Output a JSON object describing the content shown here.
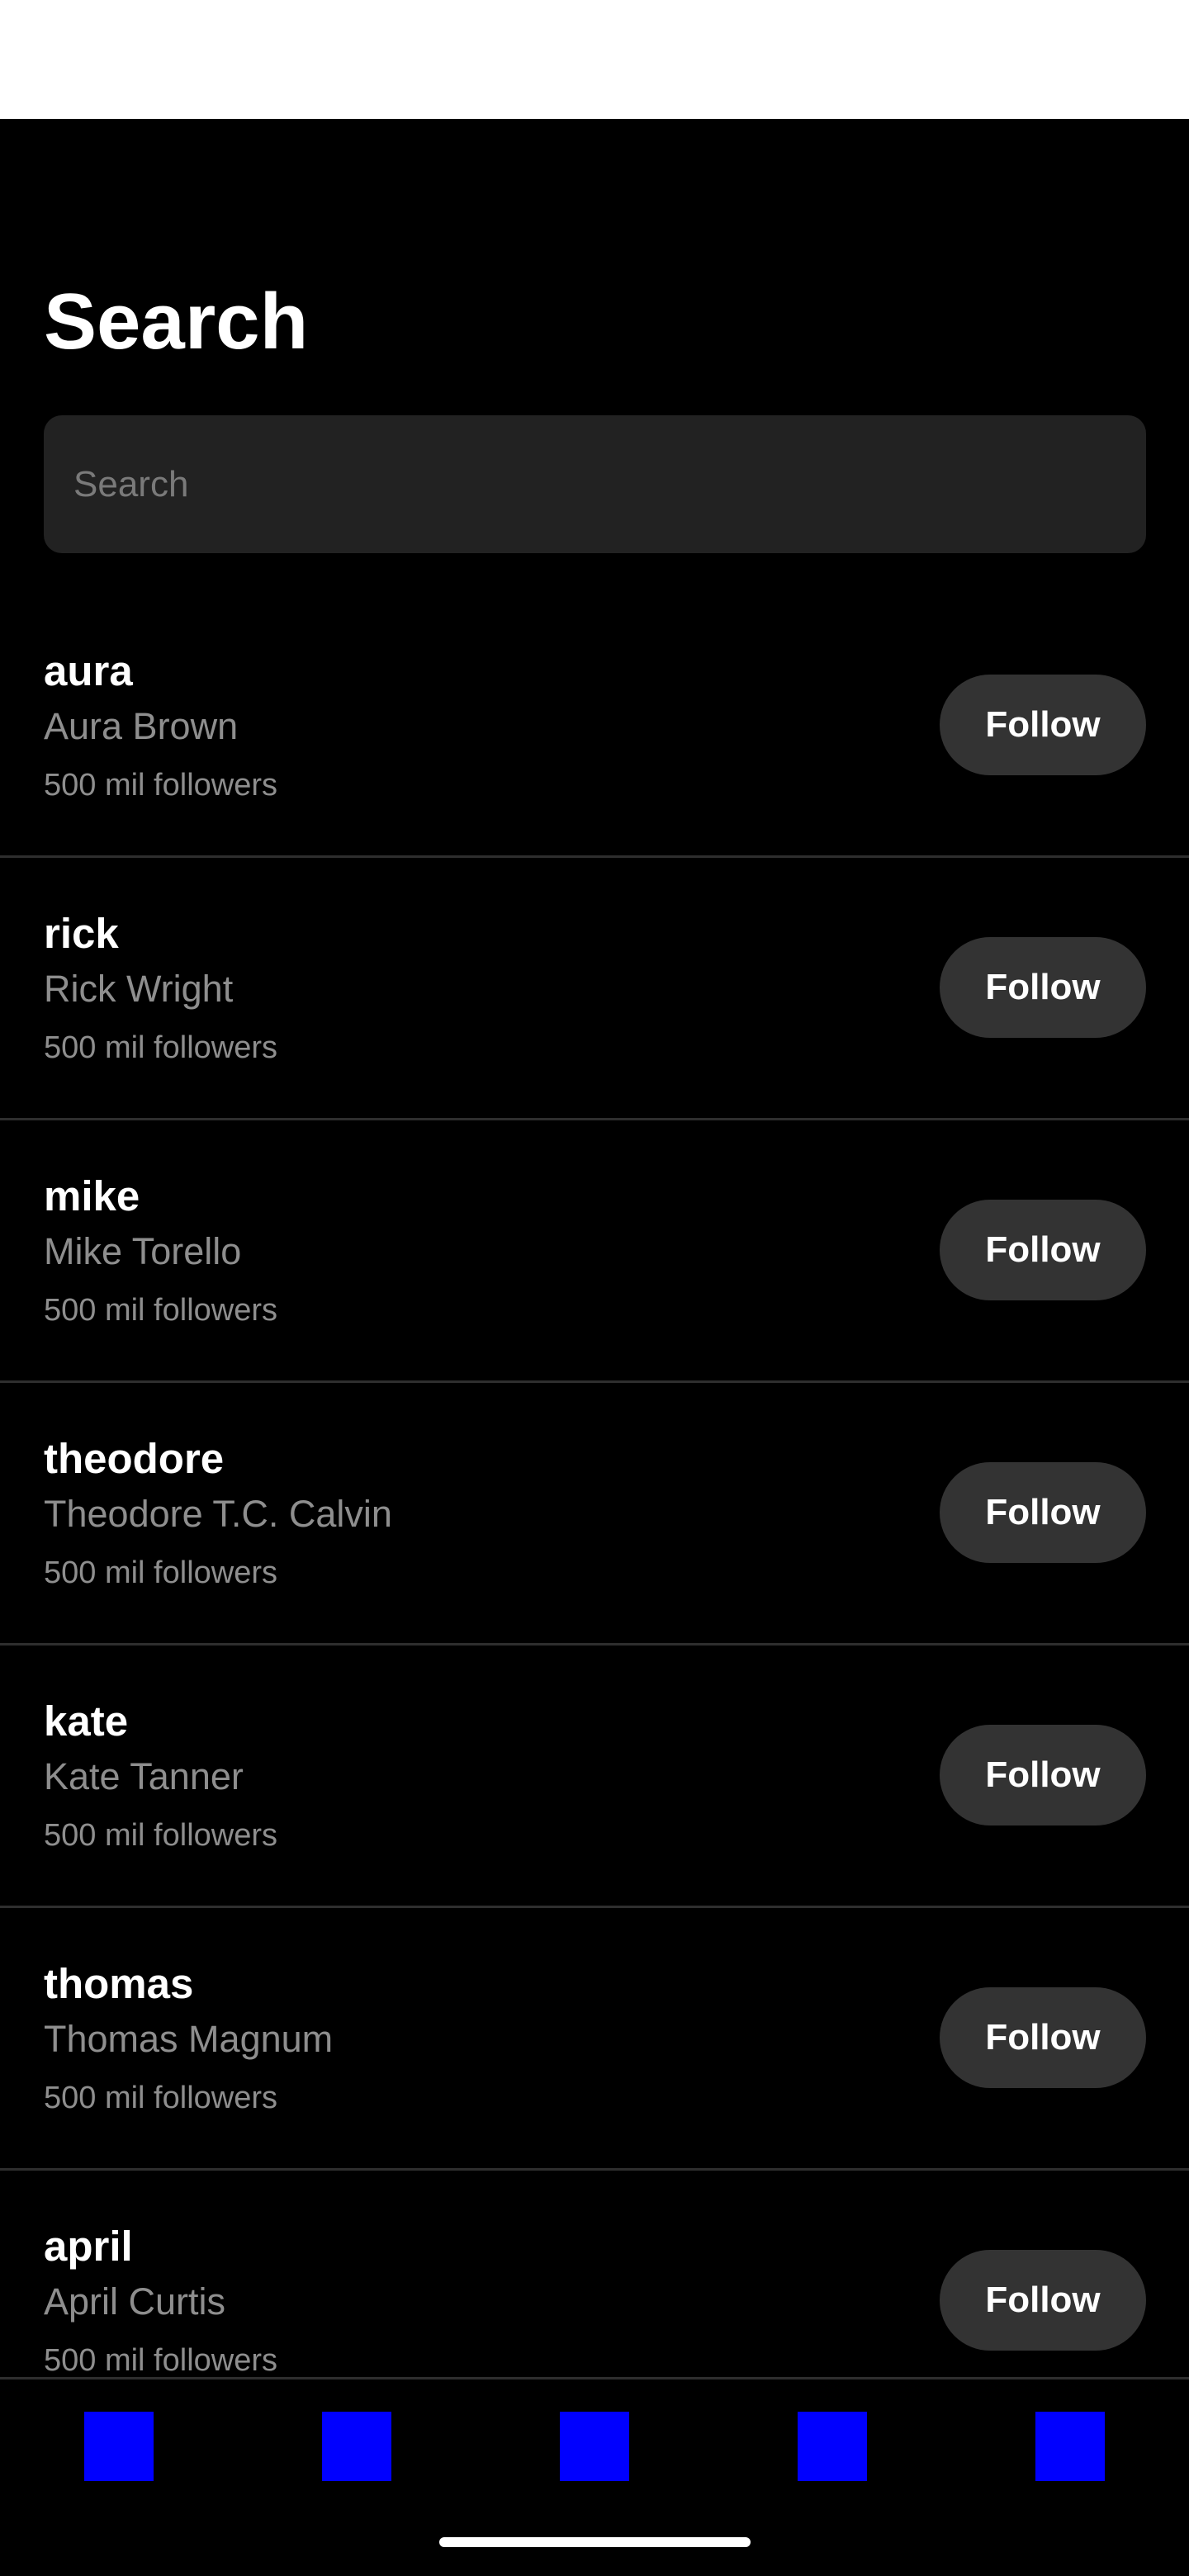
{
  "header": {
    "title": "Search"
  },
  "search": {
    "placeholder": "Search",
    "value": ""
  },
  "results": [
    {
      "username": "aura",
      "full_name": "Aura Brown",
      "followers": "500 mil followers",
      "action_label": "Follow"
    },
    {
      "username": "rick",
      "full_name": "Rick Wright",
      "followers": "500 mil followers",
      "action_label": "Follow"
    },
    {
      "username": "mike",
      "full_name": "Mike Torello",
      "followers": "500 mil followers",
      "action_label": "Follow"
    },
    {
      "username": "theodore",
      "full_name": "Theodore T.C. Calvin",
      "followers": "500 mil followers",
      "action_label": "Follow"
    },
    {
      "username": "kate",
      "full_name": "Kate Tanner",
      "followers": "500 mil followers",
      "action_label": "Follow"
    },
    {
      "username": "thomas",
      "full_name": "Thomas Magnum",
      "followers": "500 mil followers",
      "action_label": "Follow"
    },
    {
      "username": "april",
      "full_name": "April Curtis",
      "followers": "500 mil followers",
      "action_label": "Follow"
    }
  ],
  "bottom_nav": {
    "items": [
      {
        "icon": "nav-tab-1-icon"
      },
      {
        "icon": "nav-tab-2-icon"
      },
      {
        "icon": "nav-tab-3-icon"
      },
      {
        "icon": "nav-tab-4-icon"
      },
      {
        "icon": "nav-tab-5-icon"
      }
    ]
  },
  "colors": {
    "background": "#000000",
    "status_bar": "#ffffff",
    "search_field": "#222222",
    "follow_button": "#333333",
    "secondary_text": "#8e8e8e",
    "nav_icon_placeholder": "#0000ff"
  }
}
